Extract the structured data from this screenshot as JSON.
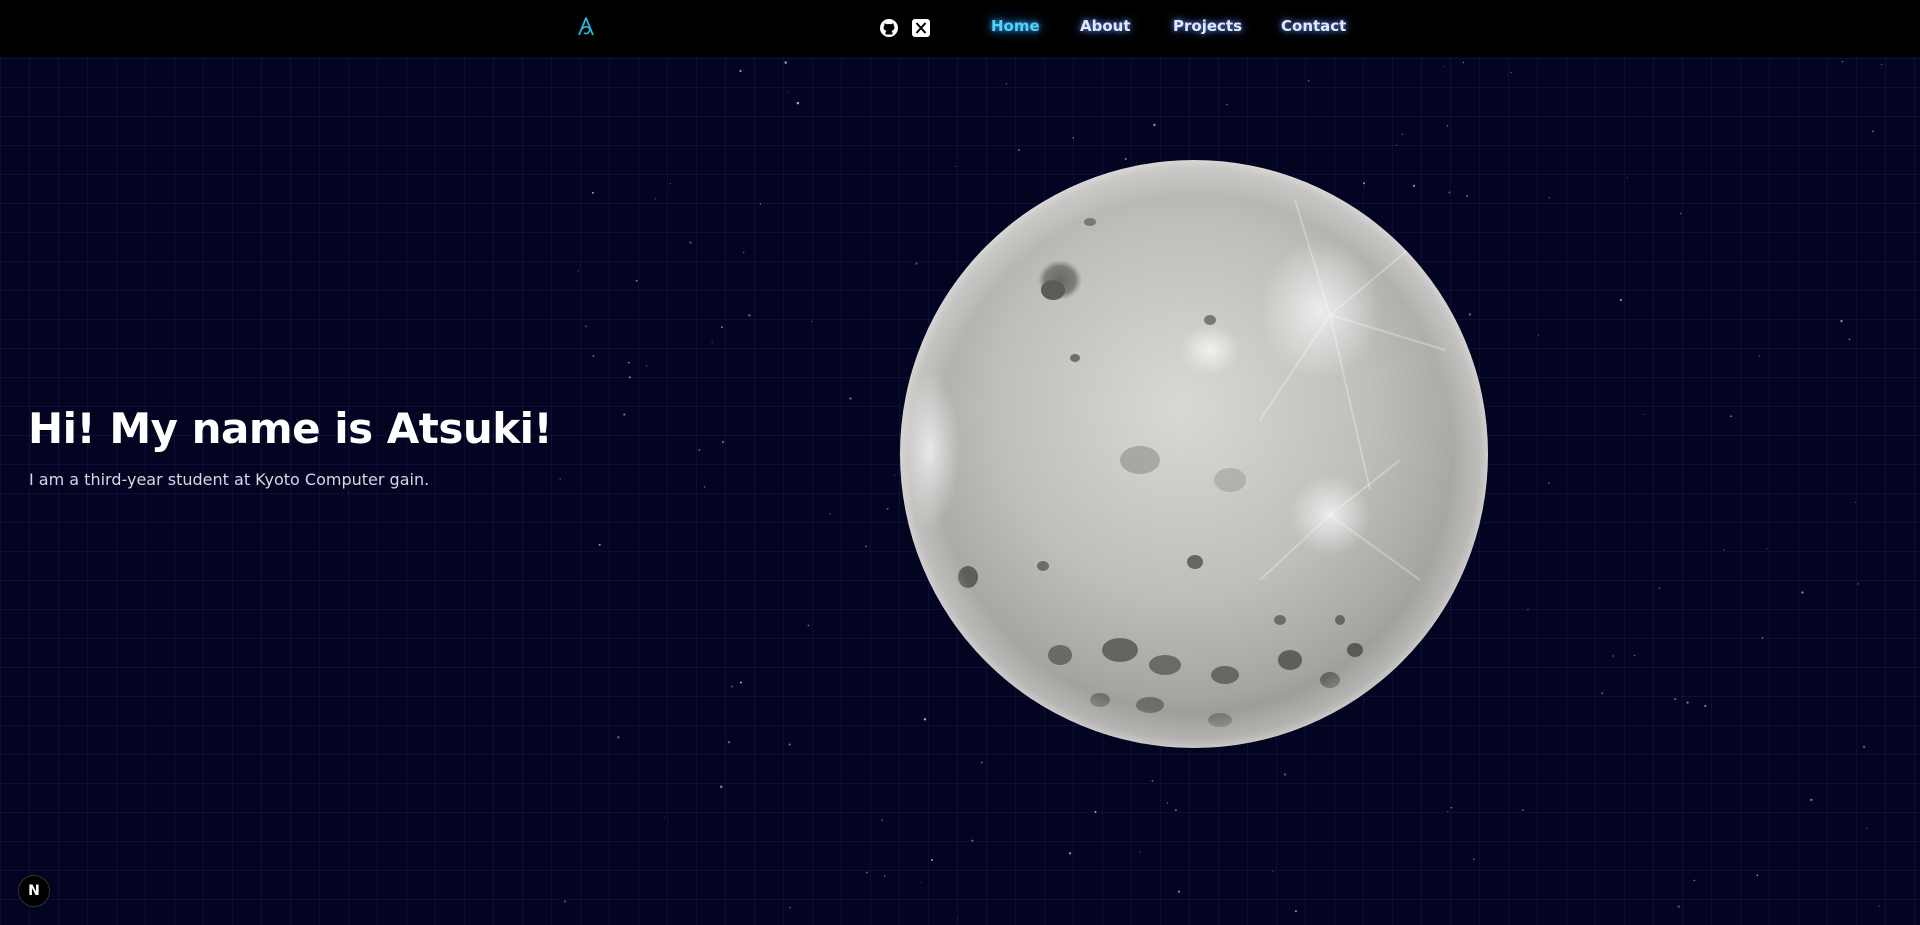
{
  "header": {
    "logo_icon": "atsuki-logo-icon",
    "social": [
      {
        "icon": "github-icon"
      },
      {
        "icon": "x-icon"
      }
    ],
    "nav": [
      {
        "label": "Home",
        "active": true
      },
      {
        "label": "About",
        "active": false
      },
      {
        "label": "Projects",
        "active": false
      },
      {
        "label": "Contact",
        "active": false
      }
    ]
  },
  "hero": {
    "title": "Hi! My name is Atsuki!",
    "subtitle": "I am a third-year student at Kyoto Computer gain."
  },
  "visual": {
    "moon": "moon-image"
  },
  "dev_badge": {
    "label": "N"
  },
  "colors": {
    "background": "#030322",
    "grid": "#2a2f6a",
    "nav_active": "#4fd3ff",
    "nav_text": "#dfe9ff",
    "logo": "#22b8e0"
  }
}
